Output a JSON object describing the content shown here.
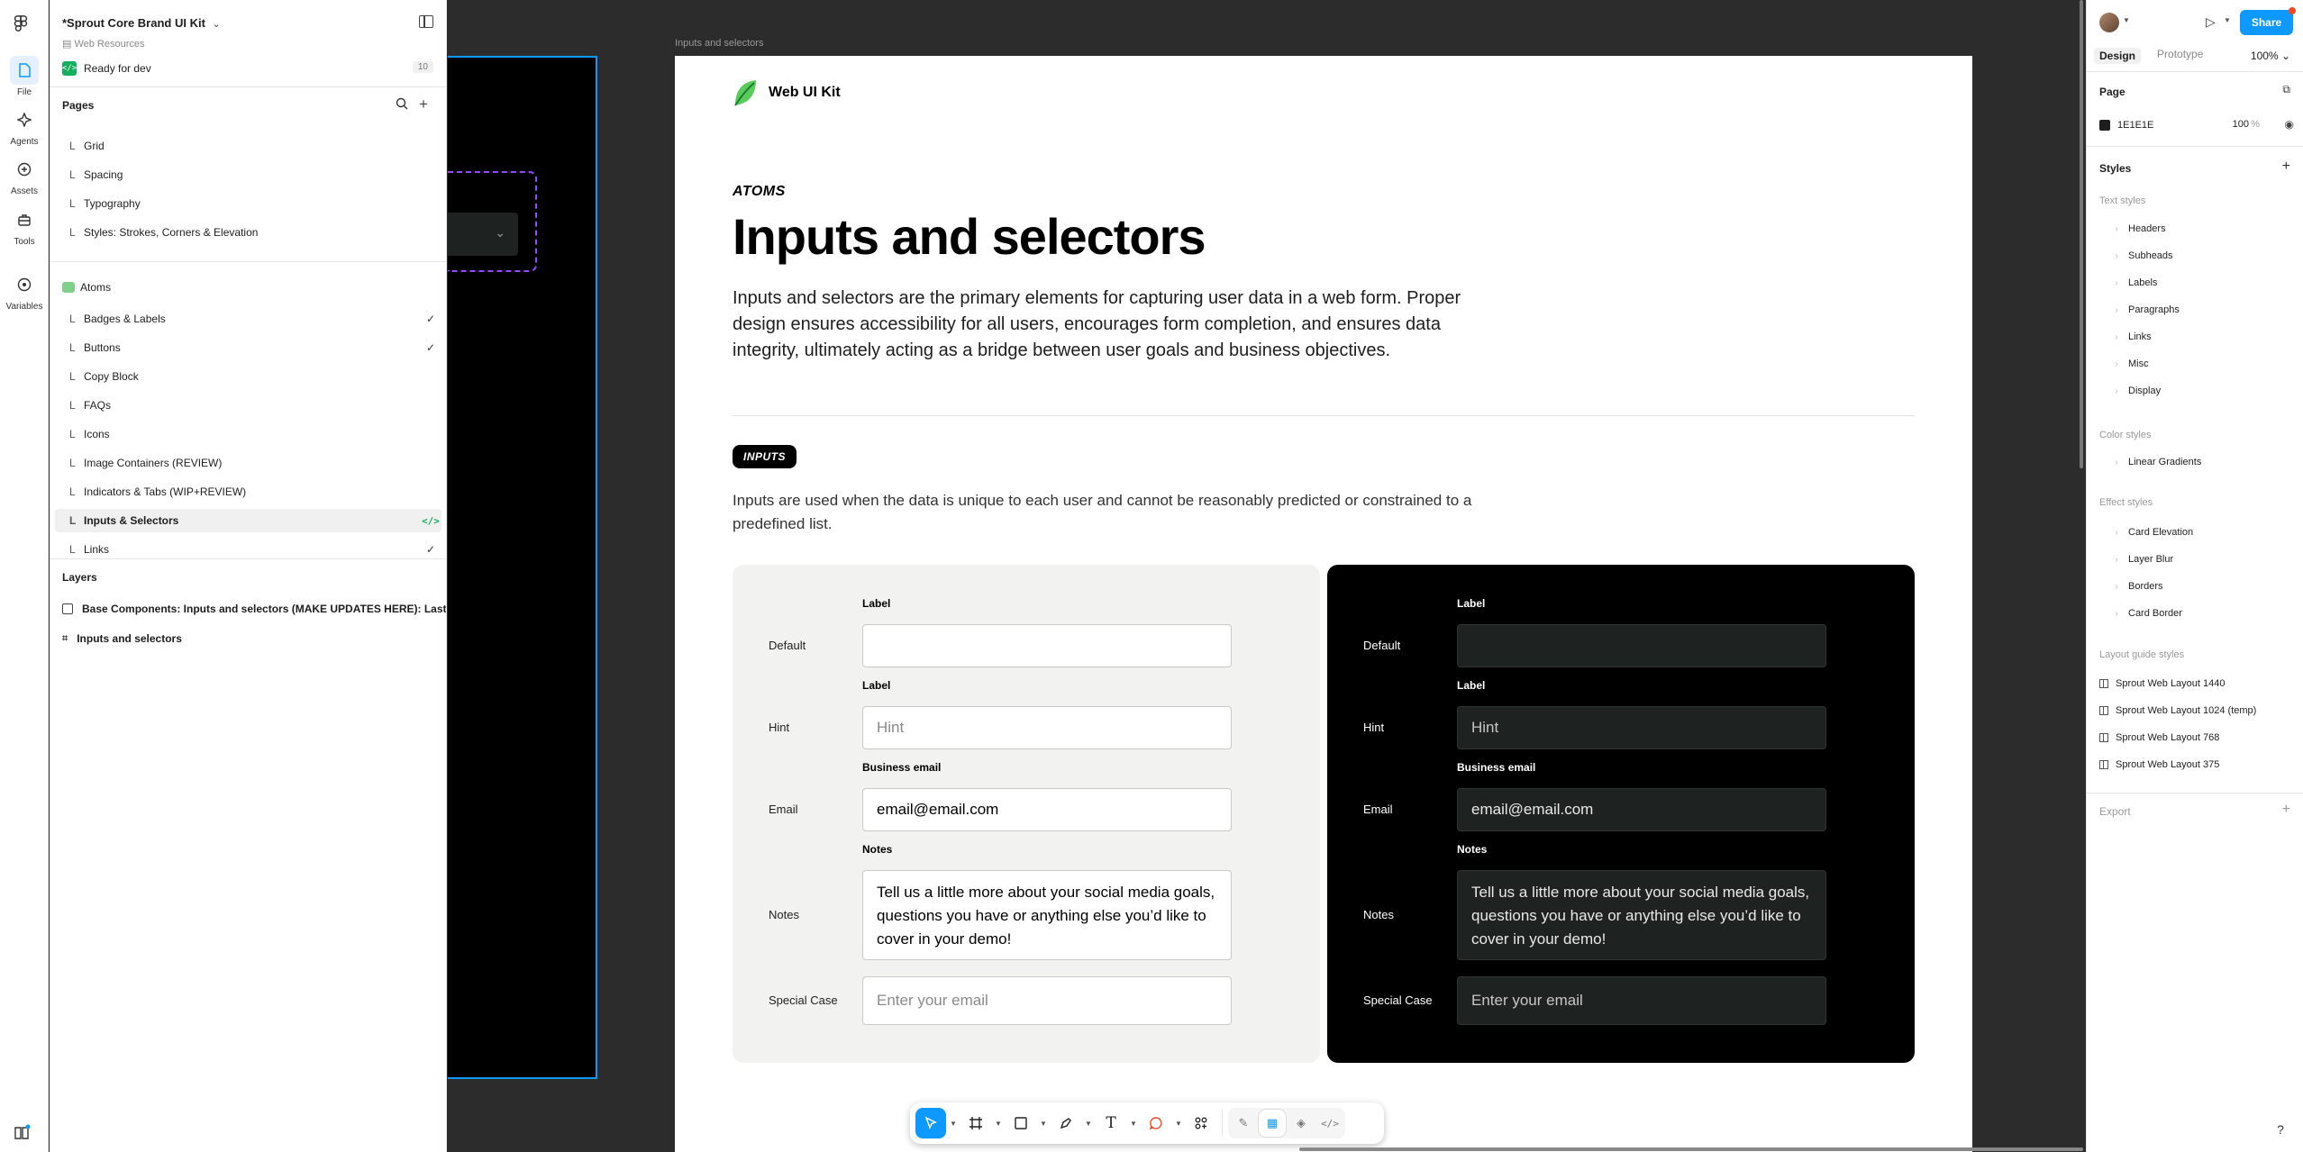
{
  "rail": {
    "items": [
      {
        "label": "File",
        "icon": "file-icon"
      },
      {
        "label": "Agents",
        "icon": "agents-icon"
      },
      {
        "label": "Assets",
        "icon": "assets-icon"
      },
      {
        "label": "Tools",
        "icon": "tools-icon"
      },
      {
        "label": "Variables",
        "icon": "variables-icon"
      }
    ]
  },
  "left": {
    "file_title": "*Sprout Core Brand UI Kit",
    "file_sub": "Web Resources",
    "ready_label": "Ready for dev",
    "ready_count": "10",
    "pages_title": "Pages",
    "pages": [
      {
        "name": "Grid",
        "mark": "L",
        "trail": ""
      },
      {
        "name": "Spacing",
        "mark": "L",
        "trail": ""
      },
      {
        "name": "Typography",
        "mark": "L",
        "trail": ""
      },
      {
        "name": "Styles: Strokes, Corners & Elevation",
        "mark": "L",
        "trail": ""
      }
    ],
    "atoms_label": "Atoms",
    "atom_pages": [
      {
        "name": "Badges & Labels",
        "mark": "L",
        "trail": "✓"
      },
      {
        "name": "Buttons",
        "mark": "L",
        "trail": "✓"
      },
      {
        "name": "Copy Block",
        "mark": "L",
        "trail": ""
      },
      {
        "name": "FAQs",
        "mark": "L",
        "trail": ""
      },
      {
        "name": "Icons",
        "mark": "L",
        "trail": ""
      },
      {
        "name": "Image Containers (REVIEW)",
        "mark": "L",
        "trail": ""
      },
      {
        "name": "Indicators & Tabs (WIP+REVIEW)",
        "mark": "L",
        "trail": ""
      },
      {
        "name": "Inputs & Selectors",
        "mark": "L",
        "trail": "</>"
      },
      {
        "name": "Links",
        "mark": "L",
        "trail": "✓"
      }
    ],
    "layers_title": "Layers",
    "layers": [
      {
        "name": "Base Components: Inputs and selectors (MAKE UPDATES HERE): Last Upda"
      },
      {
        "name": "Inputs and selectors"
      }
    ]
  },
  "canvas": {
    "frame_label": "Inputs and selectors",
    "brand": "Web UI Kit",
    "eyebrow": "ATOMS",
    "title": "Inputs and selectors",
    "lede": "Inputs and selectors are the primary elements for capturing user data in a web form. Proper design ensures accessibility for all users, encourages form completion, and ensures data integrity, ultimately acting as a bridge between user goals and business objectives.",
    "pill": "INPUTS",
    "desc": "Inputs are used when the data is unique to each user and cannot be reasonably predicted or constrained to a predefined list.",
    "rows": [
      {
        "side": "Default",
        "label": "Label",
        "value": "",
        "placeholder": false
      },
      {
        "side": "Hint",
        "label": "Label",
        "value": "Hint",
        "placeholder": true
      },
      {
        "side": "Email",
        "label": "Business email",
        "value": "email@email.com",
        "placeholder": false
      },
      {
        "side": "Notes",
        "label": "Notes",
        "value": "Tell us a little more about your social media goals, questions you have or anything else you’d like to cover in your demo!",
        "placeholder": false
      },
      {
        "side": "Special Case",
        "label": "",
        "value": "Enter your email",
        "placeholder": true
      }
    ]
  },
  "right": {
    "share": "Share",
    "tab_design": "Design",
    "tab_prototype": "Prototype",
    "zoom": "100%",
    "page_title": "Page",
    "page_color": "1E1E1E",
    "page_opacity": "100",
    "page_pct": "%",
    "styles_title": "Styles",
    "text_styles": "Text styles",
    "text_items": [
      "Headers",
      "Subheads",
      "Labels",
      "Paragraphs",
      "Links",
      "Misc",
      "Display"
    ],
    "color_styles": "Color styles",
    "color_items": [
      "Linear Gradients"
    ],
    "effect_styles": "Effect styles",
    "effect_items": [
      "Card Elevation",
      "Layer Blur",
      "Borders",
      "Card Border"
    ],
    "layout_styles": "Layout guide styles",
    "layout_items": [
      "Sprout Web Layout 1440",
      "Sprout Web Layout 1024 (temp)",
      "Sprout Web Layout 768",
      "Sprout Web Layout 375"
    ],
    "export_title": "Export"
  },
  "colors": {
    "accent": "#0d99ff",
    "dev_green": "#14ae5c",
    "canvas_bg": "#2c2c2c",
    "dark_card": "#000000",
    "dark_input": "#1e2321",
    "light_card": "#f2f2f1",
    "dashed": "#9747ff"
  }
}
